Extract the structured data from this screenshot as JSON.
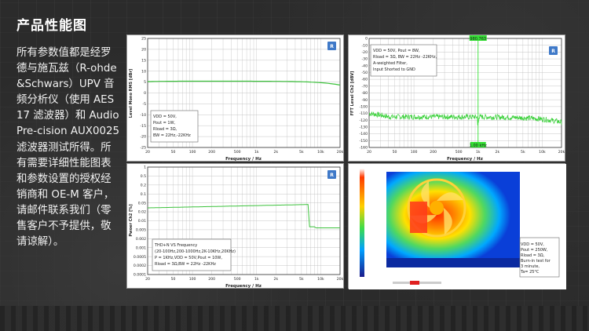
{
  "page": {
    "title": "产品性能图",
    "description": "所有参数值都是经罗德与施瓦兹（R-ohde&Schwars）UPV 音频分析仪（使用 AES17 滤波器）和 Audio Pre-cision AUX0025 滤波器测试所得。所有需要详细性能图表和参数设置的授权经销商和 OE-M 客户，请邮件联系我们（零售客户不予提供，敬请谅解）。"
  },
  "charts": {
    "freq_response": {
      "ylabel": "Level Mono RMS [dBr]",
      "xlabel": "Frequency / Hz",
      "yticks": [
        "25",
        "20",
        "15",
        "10",
        "5",
        "0",
        "-5",
        "-10",
        "-15",
        "-20",
        "-25"
      ],
      "xticks": [
        "20",
        "50",
        "100",
        "200",
        "500",
        "1k",
        "2k",
        "5k",
        "10k",
        "20k"
      ],
      "legend": [
        "VDD = 50V,",
        "Pout = 1W,",
        "Rload = 3Ω,",
        "BW = 22Hz,-22KHz"
      ]
    },
    "fft": {
      "ylabel": "FFT Level Ch2 [dBV]",
      "xlabel": "Frequency / Hz",
      "yticks": [
        "0",
        "-10",
        "-20",
        "-30",
        "-40",
        "-50",
        "-60",
        "-70",
        "-80",
        "-90",
        "-100",
        "-110",
        "-120",
        "-130",
        "-140",
        "-150",
        "-160"
      ],
      "xticks": [
        "20",
        "50",
        "100",
        "200",
        "500",
        "1k",
        "2k",
        "5k",
        "10k",
        "20k"
      ],
      "marker_top": "980.763",
      "marker_bottom": "1.00 kHz",
      "legend": [
        "VDD = 50V, Pout = 8W,",
        "Rload = 3Ω, BW = 22Hz -22KHz,",
        "A-weighted Filter,",
        "Input Shorted to GND"
      ]
    },
    "thd": {
      "ylabel": "Pwoer Ch2 [%]",
      "xlabel": "Frequency / Hz",
      "yticks": [
        "1",
        "0.5",
        "0.2",
        "0.1",
        "0.05",
        "0.02",
        "0.01",
        "0.005",
        "0.002",
        "0.001",
        "0.0005",
        "0.0002",
        "0.0001"
      ],
      "xticks": [
        "20",
        "50",
        "100",
        "200",
        "500",
        "1k",
        "2k",
        "5k",
        "10k",
        "20k"
      ],
      "legend": [
        "THD+N VS  Frequency",
        "(20-100Hz,200-1000Hz,2K-10KHz,20KHz)",
        "P = 1KHz,VDD = 50V,Pout = 10W,",
        "Rload = 3Ω,BW = 22Hz -22KHz"
      ]
    },
    "thermal": {
      "legend": [
        "VDD = 50V,",
        "Pout = 250W,",
        "Rload = 3Ω,",
        "Burn-in test for",
        "3 minute,",
        "Ta= 25°C"
      ]
    }
  },
  "colors": {
    "curve": "#3cc23c",
    "fft_curve": "#35d035",
    "marker": "#34e034",
    "grid": "#b8b8b8"
  }
}
